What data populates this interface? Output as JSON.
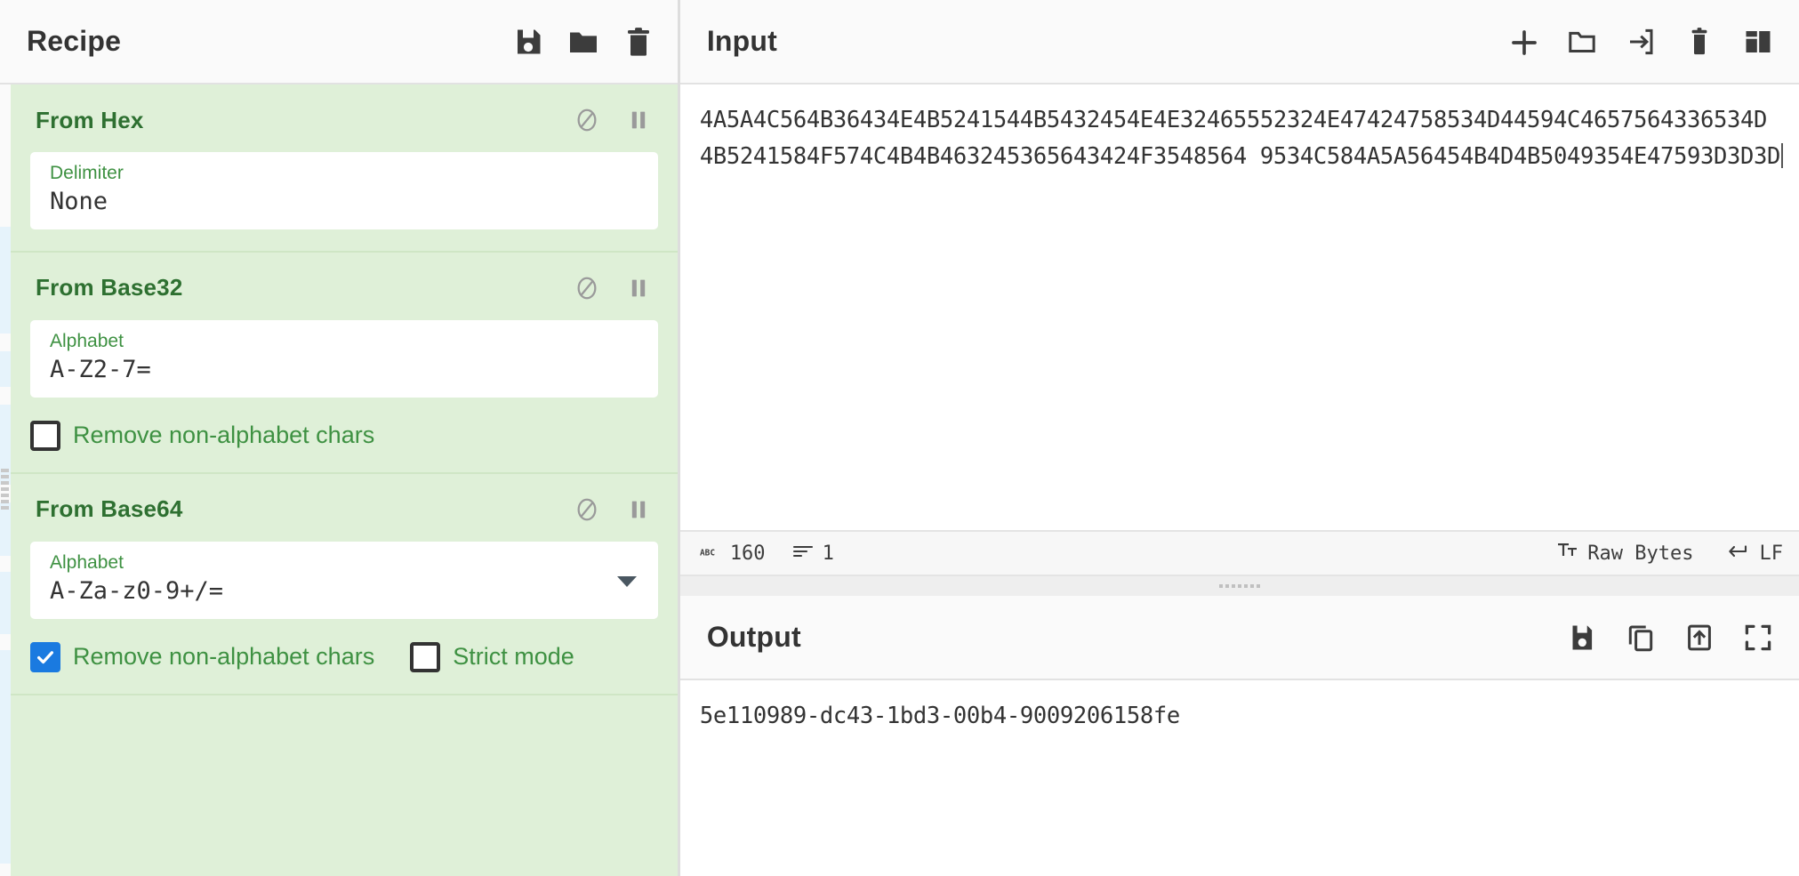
{
  "recipe": {
    "title": "Recipe",
    "tools": [
      {
        "name": "save-recipe-icon",
        "label": "Save recipe"
      },
      {
        "name": "load-recipe-icon",
        "label": "Load recipe"
      },
      {
        "name": "clear-recipe-icon",
        "label": "Clear recipe"
      }
    ],
    "operations": [
      {
        "name": "From Hex",
        "disable_label": "Disable operation",
        "breakpoint_label": "Set breakpoint",
        "args": [
          {
            "type": "text",
            "label": "Delimiter",
            "value": "None",
            "dropdown": false
          }
        ],
        "checkboxes": []
      },
      {
        "name": "From Base32",
        "disable_label": "Disable operation",
        "breakpoint_label": "Set breakpoint",
        "args": [
          {
            "type": "text",
            "label": "Alphabet",
            "value": "A-Z2-7=",
            "dropdown": false
          }
        ],
        "checkboxes": [
          {
            "label": "Remove non-alphabet chars",
            "checked": false
          }
        ]
      },
      {
        "name": "From Base64",
        "disable_label": "Disable operation",
        "breakpoint_label": "Set breakpoint",
        "args": [
          {
            "type": "select",
            "label": "Alphabet",
            "value": "A-Za-z0-9+/=",
            "dropdown": true
          }
        ],
        "checkboxes": [
          {
            "label": "Remove non-alphabet chars",
            "checked": true
          },
          {
            "label": "Strict mode",
            "checked": false
          }
        ]
      }
    ]
  },
  "input": {
    "title": "Input",
    "tools": [
      {
        "name": "add-input-tab-icon",
        "label": "Add a new input tab"
      },
      {
        "name": "open-folder-icon",
        "label": "Open folder as input"
      },
      {
        "name": "open-file-icon",
        "label": "Open file as input"
      },
      {
        "name": "clear-input-icon",
        "label": "Clear input and output"
      },
      {
        "name": "reset-pane-layout-icon",
        "label": "Reset pane layout"
      }
    ],
    "lines": [
      "4A5A4C564B36434E4B5241544B5432454E4E32465552324E47424758534D44594C4657564336534D",
      "4B5241584F574C4B4B463245365643424F3548564 9534C584A5A56454B4D4B5049354E47593D3D3D"
    ],
    "status": {
      "length_icon": "abc-icon",
      "length": "160",
      "lines_icon": "lines-icon",
      "lines": "1",
      "encoding_icon": "character-encoding-icon",
      "encoding": "Raw Bytes",
      "eol_icon": "line-ending-icon",
      "eol": "LF"
    }
  },
  "output": {
    "title": "Output",
    "tools": [
      {
        "name": "save-output-icon",
        "label": "Save output to file"
      },
      {
        "name": "copy-output-icon",
        "label": "Copy raw output to the clipboard"
      },
      {
        "name": "bake-to-input-icon",
        "label": "Replace input with output"
      },
      {
        "name": "maximise-output-icon",
        "label": "Maximise output pane"
      }
    ],
    "text": "5e110989-dc43-1bd3-00b4-9009206158fe"
  },
  "colors": {
    "recipe_bg": "#dff0d8",
    "op_label": "#3e9142",
    "op_title": "#2e7031",
    "checkbox_on": "#1a7ae0",
    "header_bg": "#fafafa",
    "text": "#333333"
  }
}
